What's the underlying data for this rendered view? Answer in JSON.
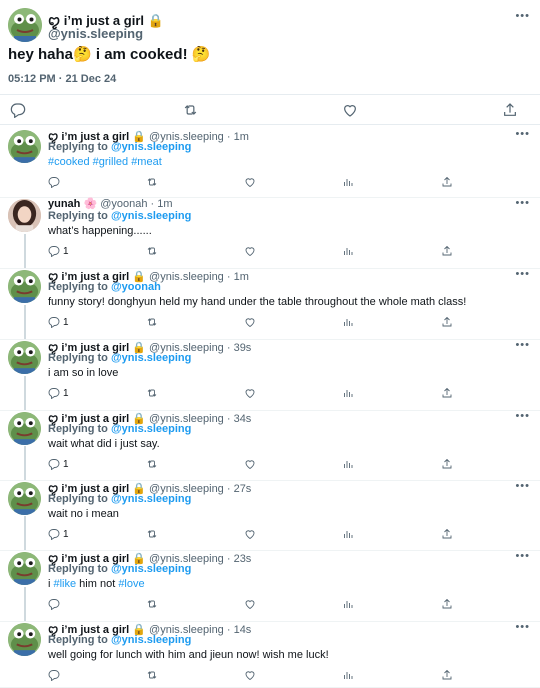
{
  "main": {
    "display_name": "ꨄ︎ i’m just a girl 🔒",
    "handle": "@ynis.sleeping",
    "text": "hey haha🤔  i am cooked! 🤔",
    "timestamp": "05:12 PM · 21 Dec 24",
    "more": "•••"
  },
  "replies": [
    {
      "name": "ꨄ︎ i’m just a girl 🔒",
      "meta": "@ynis.sleeping · 1m",
      "replying_prefix": "Replying to",
      "replying_to": "@ynis.sleeping",
      "text_parts": [
        "#cooked",
        " ",
        "#grilled",
        " ",
        "#meat"
      ],
      "reply_count": "",
      "avatar": "pepe"
    },
    {
      "name": "yunah 🌸",
      "meta": "@yoonah · 1m",
      "replying_prefix": "Replying to",
      "replying_to": "@ynis.sleeping",
      "text": "what’s happening......",
      "reply_count": "1",
      "avatar": "girl"
    },
    {
      "name": "ꨄ︎ i’m just a girl 🔒",
      "meta": "@ynis.sleeping · 1m",
      "replying_prefix": "Replying to",
      "replying_to": "@yoonah",
      "text": "funny story! donghyun held my hand under the table throughout the whole math class!",
      "reply_count": "1",
      "avatar": "pepe"
    },
    {
      "name": "ꨄ︎ i’m just a girl 🔒",
      "meta": "@ynis.sleeping · 39s",
      "replying_prefix": "Replying to",
      "replying_to": "@ynis.sleeping",
      "text": "i am so in love",
      "reply_count": "1",
      "avatar": "pepe"
    },
    {
      "name": "ꨄ︎ i’m just a girl 🔒",
      "meta": "@ynis.sleeping · 34s",
      "replying_prefix": "Replying to",
      "replying_to": "@ynis.sleeping",
      "text": "wait what did i just say.",
      "reply_count": "1",
      "avatar": "pepe"
    },
    {
      "name": "ꨄ︎ i’m just a girl 🔒",
      "meta": "@ynis.sleeping · 27s",
      "replying_prefix": "Replying to",
      "replying_to": "@ynis.sleeping",
      "text": "wait no i mean",
      "reply_count": "1",
      "avatar": "pepe"
    },
    {
      "name": "ꨄ︎ i’m just a girl 🔒",
      "meta": "@ynis.sleeping · 23s",
      "replying_prefix": "Replying to",
      "replying_to": "@ynis.sleeping",
      "text_parts": [
        "i ",
        "#like",
        " him not ",
        "#love"
      ],
      "reply_count": "",
      "avatar": "pepe"
    },
    {
      "name": "ꨄ︎ i’m just a girl 🔒",
      "meta": "@ynis.sleeping · 14s",
      "replying_prefix": "Replying to",
      "replying_to": "@ynis.sleeping",
      "text": "well going for lunch with him and jieun now! wish me luck!",
      "reply_count": "",
      "avatar": "pepe"
    }
  ],
  "colors": {
    "accent": "#1d9bf0",
    "muted": "#536471",
    "text": "#0f1419",
    "divider": "#eff3f4"
  },
  "icons": [
    "reply-icon",
    "retweet-icon",
    "like-icon",
    "views-icon",
    "share-icon",
    "more-icon",
    "lock-icon"
  ]
}
